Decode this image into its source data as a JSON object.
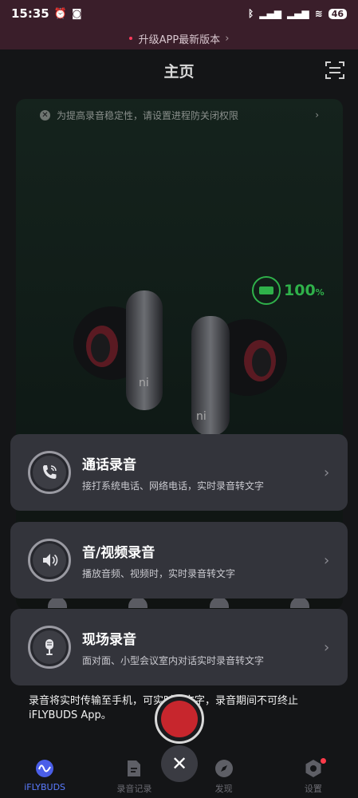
{
  "status": {
    "time": "15:35",
    "battery": "46"
  },
  "upgrade": {
    "text": "升级APP最新版本",
    "arrow": "›"
  },
  "header": {
    "title": "主页"
  },
  "notice": {
    "text": "为提高录音稳定性，请设置进程防关闭权限",
    "arrow": "›"
  },
  "device": {
    "battery_percent": "100",
    "percent_sign": "%"
  },
  "cards": [
    {
      "title": "通话录音",
      "desc": "接打系统电话、网络电话，实时录音转文字",
      "icon": "phone-icon"
    },
    {
      "title": "音/视频录音",
      "desc": "播放音频、视频时，实时录音转文字",
      "icon": "speaker-icon"
    },
    {
      "title": "现场录音",
      "desc": "面对面、小型会议室内对话实时录音转文字",
      "icon": "microphone-icon"
    }
  ],
  "hint": "录音将实时传输至手机，可实时转文字，录音期间不可终止iFLYBUDS App。",
  "tabs": [
    {
      "label": "iFLYBUDS",
      "icon": "wave-icon",
      "active": true
    },
    {
      "label": "录音记录",
      "icon": "document-icon",
      "active": false
    },
    {
      "label": "发现",
      "icon": "compass-icon",
      "active": false
    },
    {
      "label": "设置",
      "icon": "settings-icon",
      "active": false
    }
  ],
  "colors": {
    "accent": "#5a7bff",
    "battery_green": "#2fb14a",
    "record_red": "#c7262d"
  }
}
